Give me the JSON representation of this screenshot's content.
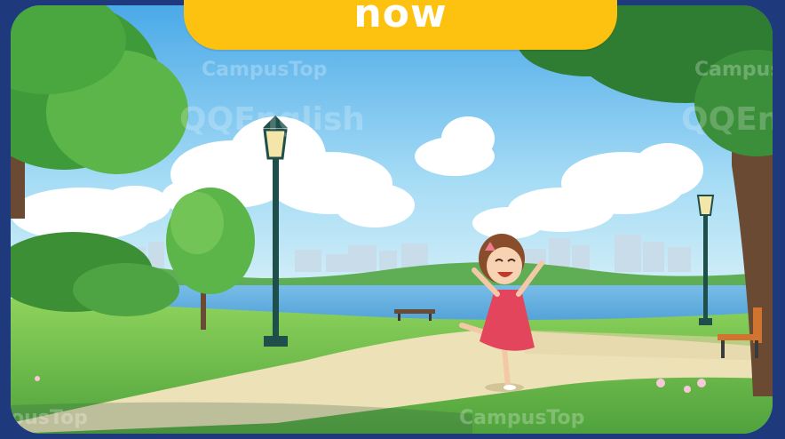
{
  "banner": {
    "word": "now"
  },
  "watermarks": {
    "brand_a": "CampusTop",
    "brand_b": "QQEnglish",
    "brand_a_alt": "CampusTop",
    "brand_b_alt": "QQEnglish",
    "brand_a_bottom": "CampusTop",
    "brand_a_edge": "ousTop"
  },
  "colors": {
    "banner": "#fdc20f",
    "frame": "#1e3a7c",
    "sky": "#7cc7ef",
    "lake": "#6fb3e2",
    "path": "#ede1b8",
    "grass": "#74c250",
    "dress": "#e2455c"
  },
  "scene": {
    "description_icons": [
      "park-scene-illustration",
      "lamp-post-icon",
      "tree-icon",
      "bench-icon",
      "girl-character-icon",
      "cloud-icon",
      "city-skyline-icon"
    ]
  }
}
